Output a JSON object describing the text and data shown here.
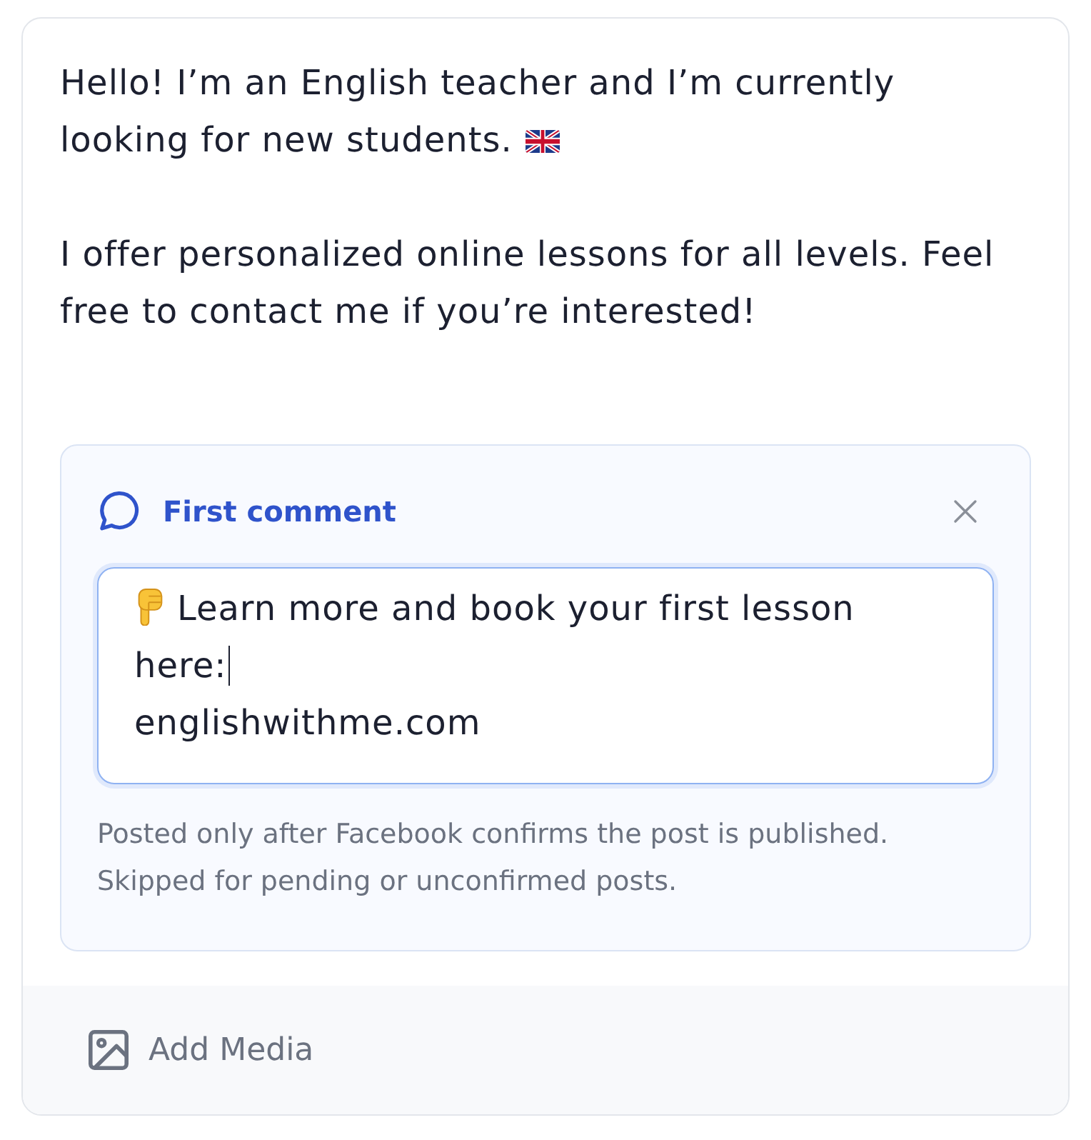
{
  "post": {
    "paragraphs": [
      {
        "text": "Hello! I’m an English teacher and I’m currently looking for new students.",
        "flag_emoji": true
      },
      {
        "text": "I offer personalized online lessons for all levels. Feel free to contact me if you’re interested!",
        "flag_emoji": false
      }
    ]
  },
  "first_comment": {
    "title": "First comment",
    "focused": true,
    "lines": [
      {
        "text": "Learn more and book your first lesson here:",
        "pointing_hand": true,
        "cursor": true
      },
      {
        "text": "englishwithme.com",
        "pointing_hand": false,
        "cursor": false
      }
    ],
    "hint": "Posted only after Facebook confirms the post is published. Skipped for pending or unconfirmed posts."
  },
  "media_button": {
    "label": "Add Media"
  }
}
